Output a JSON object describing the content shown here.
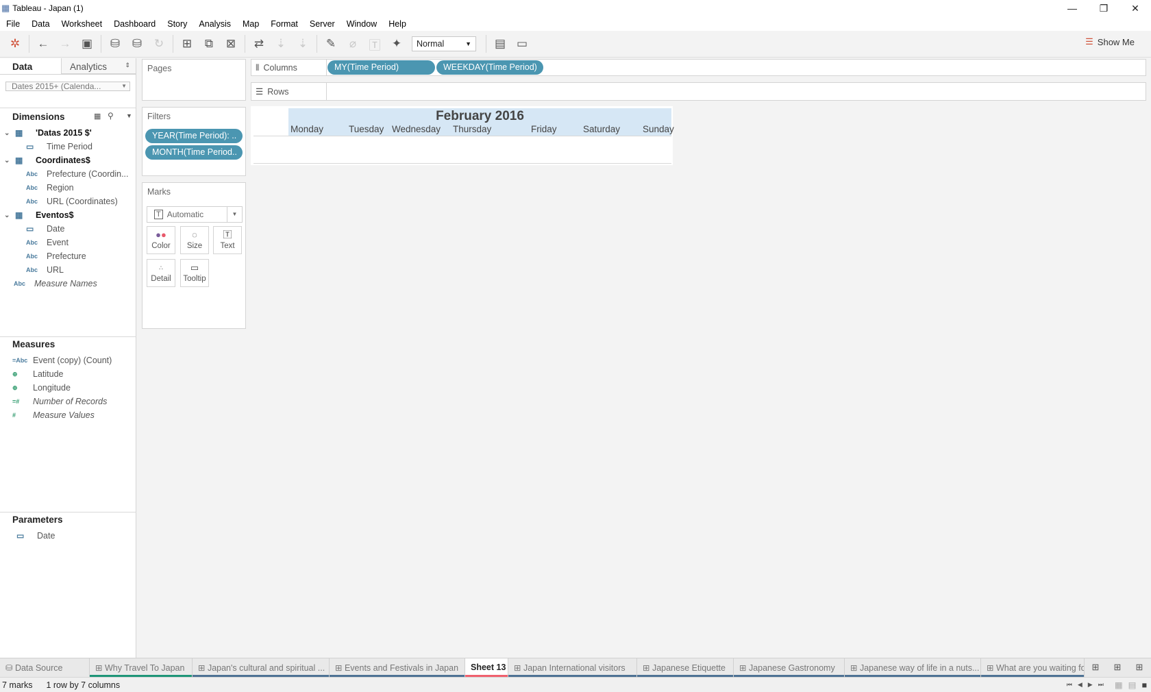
{
  "window": {
    "title": "Tableau - Japan (1)",
    "minimize": "—",
    "restore": "❐",
    "close": "✕"
  },
  "menu": [
    "File",
    "Data",
    "Worksheet",
    "Dashboard",
    "Story",
    "Analysis",
    "Map",
    "Format",
    "Server",
    "Window",
    "Help"
  ],
  "toolbar": {
    "mark_size": "Normal",
    "show_me": "Show Me"
  },
  "left": {
    "tab_data": "Data",
    "tab_analytics": "Analytics",
    "datasource": "Dates 2015+ (Calenda...",
    "dimensions_label": "Dimensions",
    "dimensions": [
      {
        "label": "'Datas 2015 $'",
        "icon": "table",
        "kind": "table"
      },
      {
        "label": "Time Period",
        "icon": "date"
      },
      {
        "label": "Coordinates$",
        "icon": "table",
        "kind": "table"
      },
      {
        "label": "Prefecture (Coordin...",
        "icon": "Abc"
      },
      {
        "label": "Region",
        "icon": "Abc"
      },
      {
        "label": "URL (Coordinates)",
        "icon": "Abc"
      },
      {
        "label": "Eventos$",
        "icon": "table",
        "kind": "table"
      },
      {
        "label": "Date",
        "icon": "date"
      },
      {
        "label": "Event",
        "icon": "Abc"
      },
      {
        "label": "Prefecture",
        "icon": "Abc"
      },
      {
        "label": "URL",
        "icon": "Abc"
      },
      {
        "label": "Measure Names",
        "icon": "Abc",
        "italic": true
      }
    ],
    "measures_label": "Measures",
    "measures": [
      {
        "label": "Event (copy) (Count)",
        "icon": "=Abc"
      },
      {
        "label": "Latitude",
        "icon": "globe"
      },
      {
        "label": "Longitude",
        "icon": "globe"
      },
      {
        "label": "Number of Records",
        "icon": "=#",
        "italic": true
      },
      {
        "label": "Measure Values",
        "icon": "#",
        "italic": true
      }
    ],
    "parameters_label": "Parameters",
    "parameters": [
      {
        "label": "Date",
        "icon": "date"
      }
    ]
  },
  "cards": {
    "pages": "Pages",
    "filters": "Filters",
    "filter_pills": [
      "YEAR(Time Period): ..",
      "MONTH(Time Period.."
    ],
    "marks": "Marks",
    "mark_type": "Automatic",
    "mark_buttons": [
      "Color",
      "Size",
      "Text",
      "Detail",
      "Tooltip"
    ]
  },
  "shelves": {
    "columns": "Columns",
    "rows": "Rows",
    "column_pills": [
      "MY(Time Period)",
      "WEEKDAY(Time Period)"
    ]
  },
  "viz": {
    "title": "February 2016",
    "days": [
      "Monday",
      "Tuesday",
      "Wednesday",
      "Thursday",
      "Friday",
      "Saturday",
      "Sunday"
    ]
  },
  "tabs": [
    {
      "label": "Data Source",
      "color": "#e9e9e9"
    },
    {
      "label": "Why Travel To Japan",
      "color": "#1e9577"
    },
    {
      "label": "Japan's cultural and spiritual ...",
      "color": "#4e7294"
    },
    {
      "label": "Events and Festivals in Japan",
      "color": "#4e7294"
    },
    {
      "label": "Sheet 13",
      "color": "#f0606e",
      "active": true
    },
    {
      "label": "Japan International visitors",
      "color": "#4e7294"
    },
    {
      "label": "Japanese Etiquette",
      "color": "#4e7294"
    },
    {
      "label": "Japanese Gastronomy",
      "color": "#4e7294"
    },
    {
      "label": "Japanese way of life in a nuts...",
      "color": "#4e7294"
    },
    {
      "label": "What are you waiting fo",
      "color": "#4e7294"
    }
  ],
  "status": {
    "marks": "7 marks",
    "dims": "1 row by 7 columns"
  }
}
